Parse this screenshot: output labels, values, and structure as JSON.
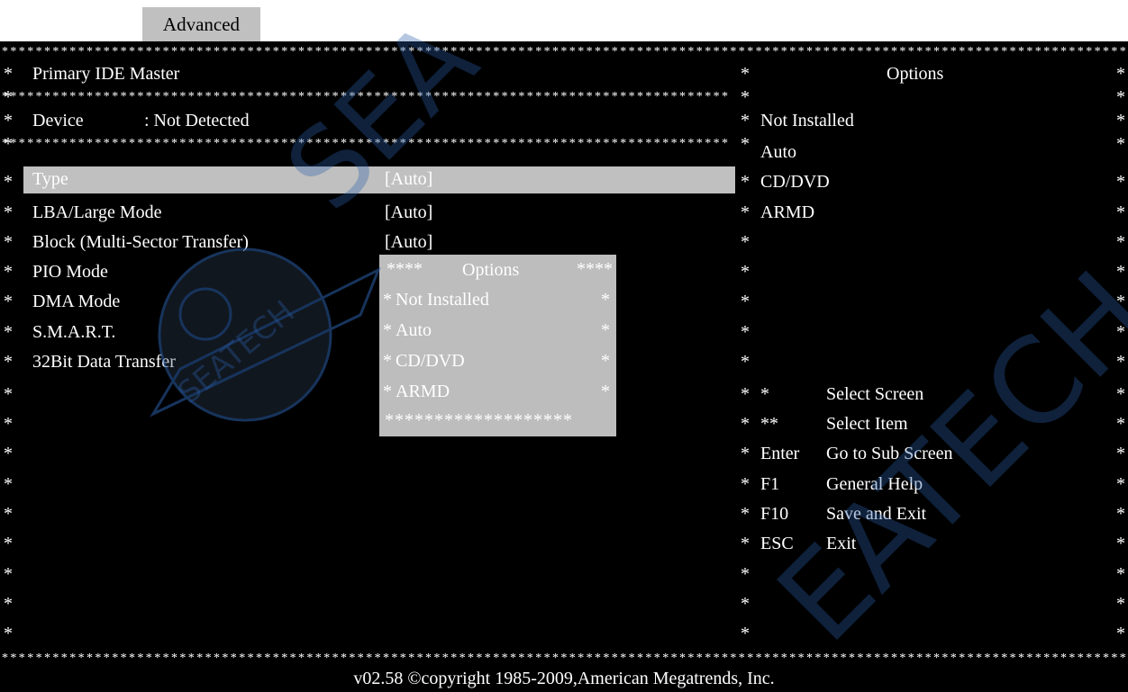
{
  "tab": {
    "label": "Advanced"
  },
  "left_panel": {
    "title": "Primary IDE  Master",
    "device_label": "Device",
    "device_value": ": Not Detected",
    "settings": [
      {
        "label": "Type",
        "value": "[Auto]"
      },
      {
        "label": "LBA/Large Mode",
        "value": "[Auto]"
      },
      {
        "label": "Block (Multi-Sector Transfer)",
        "value": "[Auto]"
      },
      {
        "label": "PIO Mode",
        "value": ""
      },
      {
        "label": "DMA Mode",
        "value": ""
      },
      {
        "label": "S.M.A.R.T.",
        "value": ""
      },
      {
        "label": "32Bit Data Transfer",
        "value": ""
      }
    ]
  },
  "popup": {
    "title": "Options",
    "title_stars": "****",
    "options": [
      "Not Installed",
      "Auto",
      "CD/DVD",
      "ARMD"
    ],
    "bottom_border": "*******************"
  },
  "right_panel": {
    "title": "Options",
    "options": [
      "Not Installed",
      "Auto",
      "CD/DVD",
      "ARMD"
    ],
    "help": [
      {
        "key": "*",
        "desc": "Select Screen"
      },
      {
        "key": "**",
        "desc": "Select Item"
      },
      {
        "key": "Enter",
        "desc": "Go to  Sub  Screen"
      },
      {
        "key": "F1",
        "desc": "General Help"
      },
      {
        "key": "F10",
        "desc": "Save and Exit"
      },
      {
        "key": "ESC",
        "desc": "Exit"
      }
    ]
  },
  "footer": {
    "text": "v02.58 ©copyright  1985-2009,American Megatrends, Inc."
  },
  "colors": {
    "background": "#000000",
    "text": "#ffffff",
    "highlight": "#c0c0c0",
    "popup": "#bdbdbd"
  }
}
